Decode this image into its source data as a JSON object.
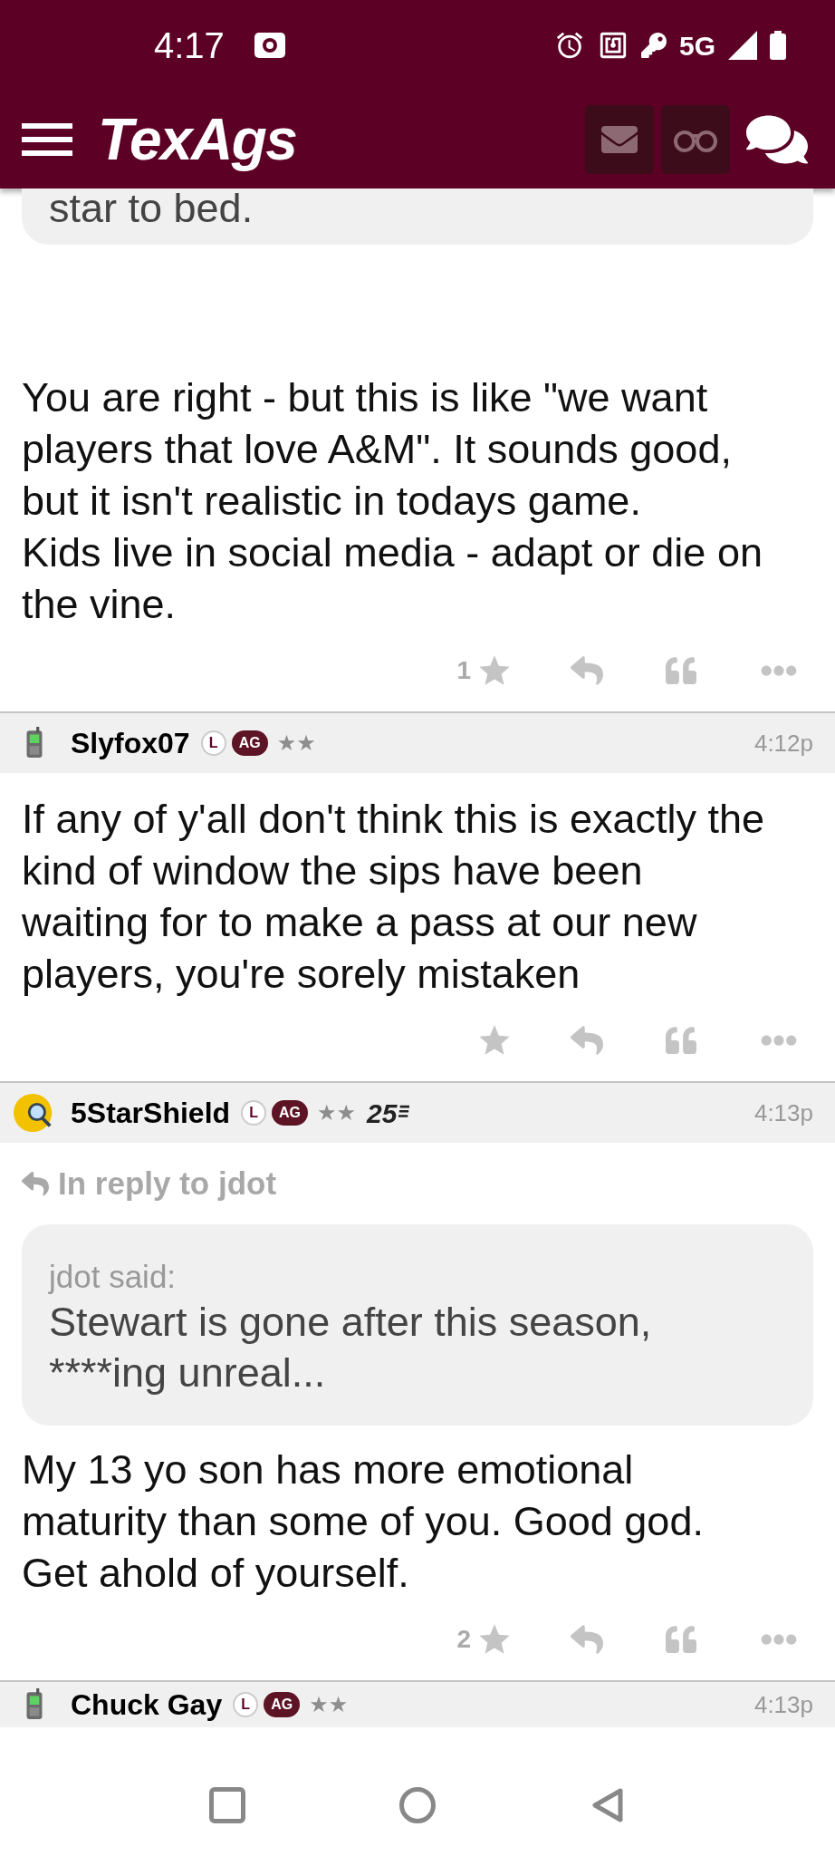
{
  "status_bar": {
    "time": "4:17",
    "network": "5G"
  },
  "header": {
    "logo": "TexAgs"
  },
  "posts": [
    {
      "kind": "partial",
      "quote": {
        "lines": [
          "star to bed."
        ]
      },
      "body": [
        "You are right - but this is like \"we want",
        "players that love A&M\". It sounds good,",
        "but it isn't realistic in todays game.",
        "Kids live in social media - adapt or die on",
        "the vine."
      ],
      "star_count": "1"
    },
    {
      "kind": "full",
      "user": {
        "name": "Slyfox07",
        "avatar": {
          "kind": "phone"
        },
        "badges": [
          {
            "kind": "circle",
            "text": "L"
          },
          {
            "kind": "pill",
            "text": "AG"
          }
        ],
        "rank_stars": "★★",
        "time": "4:12p"
      },
      "body": [
        "If any of y'all don't think this is exactly the",
        "kind of window the sips have been",
        "waiting for to make a pass at our new",
        "players, you're sorely mistaken"
      ]
    },
    {
      "kind": "full",
      "user": {
        "name": "5StarShield",
        "avatar": {
          "kind": "magnifier"
        },
        "badges": [
          {
            "kind": "circle",
            "text": "L"
          },
          {
            "kind": "pill",
            "text": "AG"
          }
        ],
        "rank_stars": "★★",
        "rank": "25",
        "time": "4:13p"
      },
      "reply_to": "In reply to jdot",
      "quote": {
        "author": "jdot said:",
        "lines": [
          "Stewart is gone after this season,",
          "****ing unreal..."
        ]
      },
      "body": [
        "My 13 yo son has more emotional",
        "maturity than some of you. Good god.",
        "Get ahold of yourself."
      ],
      "star_count": "2"
    },
    {
      "kind": "header_only",
      "user": {
        "name": "Chuck Gay",
        "avatar": {
          "kind": "phone"
        },
        "badges": [
          {
            "kind": "circle",
            "text": "L"
          },
          {
            "kind": "pill",
            "text": "AG"
          }
        ],
        "rank_stars": "★★",
        "time": "4:13p"
      }
    }
  ]
}
